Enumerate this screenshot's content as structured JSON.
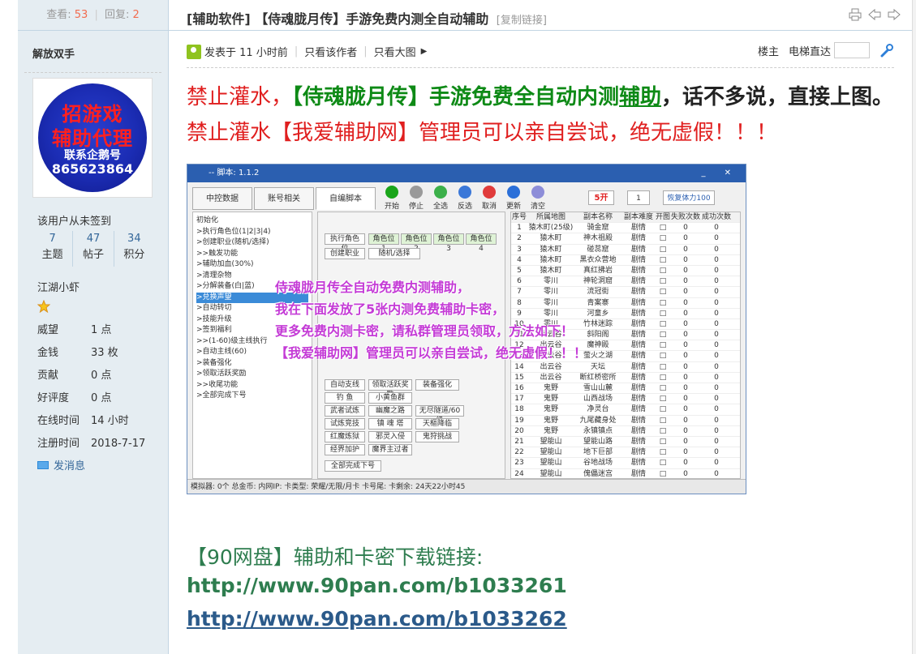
{
  "thread": {
    "title": "[辅助软件] 【侍魂胧月传】手游免费内测全自动辅助",
    "copy_link": "[复制链接]",
    "views_label": "查看:",
    "views": "53",
    "replies_label": "回复:",
    "replies": "2"
  },
  "author": {
    "name": "解放双手",
    "avatar_lines": [
      "招游戏",
      "辅助代理",
      "联系企鹅号",
      "865623864"
    ],
    "sign_status": "该用户从未签到",
    "counts": [
      {
        "value": "7",
        "label": "主题"
      },
      {
        "value": "47",
        "label": "帖子"
      },
      {
        "value": "34",
        "label": "积分"
      }
    ],
    "rank": "江湖小虾",
    "fields": [
      {
        "label": "威望",
        "value": "1 点"
      },
      {
        "label": "金钱",
        "value": "33 枚"
      },
      {
        "label": "贡献",
        "value": "0 点"
      },
      {
        "label": "好评度",
        "value": "0 点"
      },
      {
        "label": "在线时间",
        "value": "14 小时"
      },
      {
        "label": "注册时间",
        "value": "2018-7-17"
      }
    ],
    "pm_label": "发消息"
  },
  "post_meta": {
    "posted": "发表于 11 小时前",
    "only_author": "只看该作者",
    "big_image": "只看大图",
    "floor": "楼主",
    "elevator": "电梯直达"
  },
  "headline": {
    "part1": "禁止灌水，",
    "part2": "【侍魂胧月传】手游免费全自动内测",
    "part3": "辅助",
    "part4": "，话不多说，直接上图。",
    "part5": "禁止灌水【我爱辅助网】管理员可以亲自尝试，绝无虚假！！！"
  },
  "screenshot": {
    "window_title": "-- 脚本: 1.1.2",
    "tabs": [
      "中控数据",
      "账号相关",
      "自编脚本"
    ],
    "toolbar": [
      "开始",
      "停止",
      "全选",
      "反选",
      "取消",
      "更新",
      "清空"
    ],
    "open_count": "5开",
    "one": "1",
    "hp_btn": "恢复体力100",
    "tree": [
      "初始化",
      ">执行角色位(1|2|3|4)",
      ">创建职业(随机/选择)",
      ">>触发功能",
      ">辅助加血(30%)",
      ">清理杂物",
      ">分解装备(白|蓝)",
      ">兑换声望",
      ">自动转切",
      ">技能升级",
      ">签到福利",
      ">>(1-60)级主线执行",
      ">自动主线(60)",
      ">装备强化",
      ">领取活跃奖励",
      ">>收尾功能",
      ">全部完成下号"
    ],
    "mid_buttons": [
      "执行角色位",
      "角色位1",
      "角色位2",
      "角色位3",
      "角色位4",
      "创建职业",
      "随机/选择",
      "自动支线",
      "领取活跃奖励",
      "装备强化",
      "钓 鱼",
      "小黄鱼群",
      "武者试炼",
      "幽魔之路",
      "无尽隧道/60级",
      "试炼竞技",
      "镇 魂 塔",
      "天樞降临",
      "红魔炼狱",
      "邪灵入侵",
      "鬼狩挑战",
      "经界加护",
      "魔界主过者",
      "全部完成下号"
    ],
    "grid_head": [
      "序号",
      "所属地图",
      "副本名称",
      "副本难度",
      "开图",
      "失败次数",
      "成功次数"
    ],
    "grid_rows": [
      [
        "1",
        "猿木町(25级)",
        "骑金窟"
      ],
      [
        "2",
        "猿木町",
        "神木祖殿"
      ],
      [
        "3",
        "猿木町",
        "碰蕊窟"
      ],
      [
        "4",
        "猿木町",
        "黑衣众营地"
      ],
      [
        "5",
        "猿木町",
        "真红拂岩"
      ],
      [
        "6",
        "零川",
        "神轮洞窟"
      ],
      [
        "7",
        "零川",
        "流冠街"
      ],
      [
        "8",
        "零川",
        "青案寨"
      ],
      [
        "9",
        "零川",
        "河童乡"
      ],
      [
        "10",
        "零川",
        "竹林迷踪"
      ],
      [
        "11",
        "出云谷",
        "斜阳阁"
      ],
      [
        "12",
        "出云谷",
        "魔神殿"
      ],
      [
        "13",
        "出云谷",
        "萤火之湖"
      ],
      [
        "14",
        "出云谷",
        "天坛"
      ],
      [
        "15",
        "出云谷",
        "断红桥密所"
      ],
      [
        "16",
        "鬼野",
        "雪山山麓"
      ],
      [
        "17",
        "鬼野",
        "山西战场"
      ],
      [
        "18",
        "鬼野",
        "净灵台"
      ],
      [
        "19",
        "鬼野",
        "九尾藏身处"
      ],
      [
        "20",
        "鬼野",
        "永镇镇点"
      ],
      [
        "21",
        "望能山",
        "望能山路"
      ],
      [
        "22",
        "望能山",
        "地下巨部"
      ],
      [
        "23",
        "望能山",
        "谷地战场"
      ],
      [
        "24",
        "望能山",
        "傀儡迷宫"
      ]
    ],
    "difficulty": "剧情",
    "zero": "0",
    "overlay": [
      "侍魂胧月传全自动免费内测辅助，",
      "我在下面发放了5张内测免费辅助卡密，",
      "更多免费内测卡密，请私群管理员领取，方法如下！",
      "【我爱辅助网】管理员可以亲自尝试，绝无虚假！！！"
    ],
    "status": "模拟器: 0个    总金币:    内网IP:    卡类型: 荣耀/无限/月卡    卡号尾:    卡剩余: 24天22小时45"
  },
  "downloads": {
    "title": "【90网盘】辅助和卡密下载链接:",
    "link1": "http://www.90pan.com/b1033261",
    "link2": "http://www.90pan.com/b1033262"
  }
}
